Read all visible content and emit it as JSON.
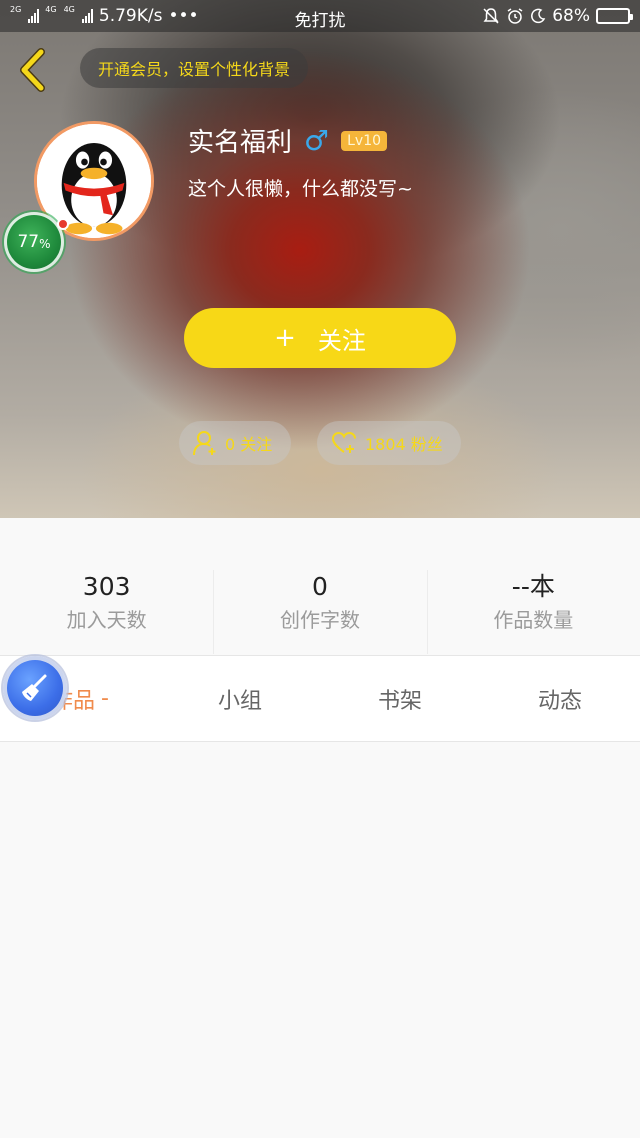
{
  "status_bar": {
    "net1": "2G",
    "net2": "4G",
    "net3": "4G",
    "speed": "5.79K/s",
    "more": "•••",
    "dnd_label": "免打扰",
    "battery_pct": "68%",
    "battery_level": 0.68,
    "icons": [
      "bell-off-icon",
      "alarm-icon",
      "moon-icon"
    ]
  },
  "header": {
    "promo_text": "开通会员，设置个性化背景",
    "name": "实名福利",
    "gender_symbol": "♂",
    "level": "Lv10",
    "bio": "这个人很懒，什么都没写~",
    "progress_text": "77",
    "progress_unit": "%",
    "progress_value": 0.77,
    "follow_plus": "+",
    "follow_label": "关注",
    "following_text": "0 关注",
    "fans_text": "1804 粉丝",
    "colors": {
      "accent_yellow": "#f7d817",
      "level_badge": "#f5b53a",
      "gender_blue": "#3aa8ea"
    }
  },
  "stats": [
    {
      "value": "303",
      "label": "加入天数"
    },
    {
      "value": "0",
      "label": "创作字数"
    },
    {
      "value": "--本",
      "label": "作品数量"
    }
  ],
  "tabs": [
    {
      "label": "作品",
      "active": true
    },
    {
      "label": "小组",
      "active": false
    },
    {
      "label": "书架",
      "active": false
    },
    {
      "label": "动态",
      "active": false
    }
  ],
  "active_tab_dash": "-",
  "active_tab_color": "#f08b4c"
}
